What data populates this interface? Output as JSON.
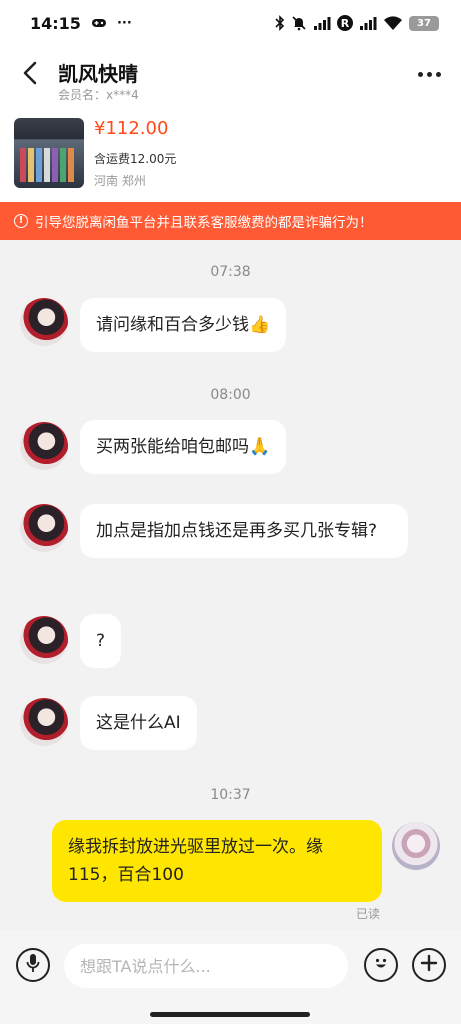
{
  "status_bar": {
    "time": "14:15",
    "extra": "···",
    "r_badge": "R",
    "battery": "37"
  },
  "header": {
    "title": "凯风快晴",
    "subtitle": "会员名：x***4"
  },
  "product": {
    "price": "¥112.00",
    "shipping": "含运费12.00元",
    "location": "河南 郑州"
  },
  "warning": {
    "icon": "!",
    "text": "引导您脱离闲鱼平台并且联系客服缴费的都是诈骗行为！"
  },
  "chat": {
    "timestamps": [
      "07:38",
      "08:00",
      "10:37"
    ],
    "messages": [
      {
        "text": "请问缘和百合多少钱👍",
        "from": "them"
      },
      {
        "text": "买两张能给咱包邮吗🙏",
        "from": "them"
      },
      {
        "text": "加点是指加点钱还是再多买几张专辑?",
        "from": "them"
      },
      {
        "text": "?",
        "from": "them"
      },
      {
        "text": "这是什么AI",
        "from": "them"
      },
      {
        "text": "缘我拆封放进光驱里放过一次。缘115，百合100",
        "from": "me"
      }
    ],
    "read_status": "已读"
  },
  "input": {
    "placeholder": "想跟TA说点什么..."
  },
  "colors": {
    "accent_orange": "#ff5a33",
    "price_red": "#ff4a1c",
    "my_bubble": "#ffe600"
  },
  "icons": [
    "back-arrow-icon",
    "more-icon",
    "microphone-icon",
    "emoji-icon",
    "plus-icon",
    "bluetooth-icon",
    "mute-icon",
    "signal-icon",
    "wifi-icon",
    "battery-icon",
    "warning-icon"
  ]
}
